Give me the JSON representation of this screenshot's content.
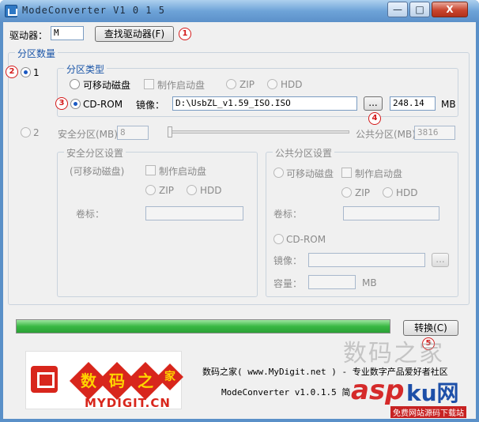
{
  "window": {
    "title": "ModeConverter V1 0 1 5",
    "min_label": "—",
    "max_label": "□",
    "close_label": "X"
  },
  "drive": {
    "label": "驱动器：",
    "value": "M",
    "find_button": "查找驱动器(F)",
    "badge": "1"
  },
  "partition_count": {
    "title": "分区数量",
    "option1_label": "1",
    "option1_badge": "2",
    "option2_label": "2"
  },
  "partition_type": {
    "title": "分区类型",
    "removable_label": "可移动磁盘",
    "make_boot_label": "制作启动盘",
    "zip_label": "ZIP",
    "hdd_label": "HDD",
    "cdrom_label": "CD-ROM",
    "cdrom_badge": "3",
    "image_label": "镜像：",
    "image_value": "D:\\UsbZL_v1.59_ISO.ISO",
    "browse_label": "...",
    "browse_badge": "4",
    "size_value": "248.14",
    "size_unit": "MB"
  },
  "two_partitions": {
    "secure_label": "安全分区(MB)",
    "secure_value": "8",
    "public_label": "公共分区(MB)",
    "public_value": "3816"
  },
  "secure_settings": {
    "title": "安全分区设置",
    "removable_label": "(可移动磁盘)",
    "make_boot_label": "制作启动盘",
    "zip_label": "ZIP",
    "hdd_label": "HDD",
    "volume_label": "卷标："
  },
  "public_settings": {
    "title": "公共分区设置",
    "removable_label": "可移动磁盘",
    "make_boot_label": "制作启动盘",
    "zip_label": "ZIP",
    "hdd_label": "HDD",
    "volume_label": "卷标：",
    "cdrom_label": "CD-ROM",
    "image_label": "镜像：",
    "browse_label": "...",
    "capacity_label": "容量：",
    "capacity_unit": "MB"
  },
  "convert": {
    "progress": 1.0,
    "button_label": "转换(C)",
    "badge": "5"
  },
  "footer": {
    "logo_chars": [
      "数",
      "码",
      "之",
      "家"
    ],
    "logo_text": "MYDIGIT.CN",
    "info_line1": "数码之家( www.MyDigit.net ) - 专业数字产品爱好者社区",
    "info_line2": "ModeConverter v1.0.1.5 简"
  },
  "watermark": {
    "line1": "数码之家",
    "brand_a": "asp",
    "brand_b": "ku网",
    "sub": "免费网站源码下载站"
  },
  "colors": {
    "accent_blue": "#1a55a8",
    "badge_red": "#d41a1a",
    "progress_green": "#39b843"
  }
}
